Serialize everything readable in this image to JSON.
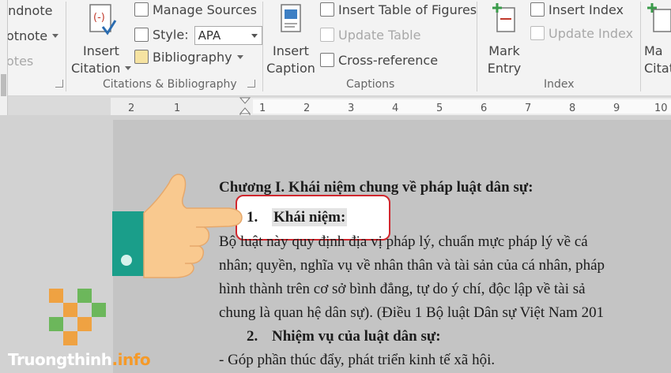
{
  "ribbon": {
    "footnotes": {
      "endnote_label": "Endnote",
      "footnote_label": "otnote",
      "notes_label": "otes"
    },
    "citations_bibliography": {
      "insert_citation_line1": "Insert",
      "insert_citation_line2": "Citation",
      "manage_sources": "Manage Sources",
      "style_label": "Style:",
      "style_value": "APA",
      "bibliography": "Bibliography",
      "group_label": "Citations & Bibliography"
    },
    "captions": {
      "insert_caption_line1": "Insert",
      "insert_caption_line2": "Caption",
      "insert_table_of_figures": "Insert Table of Figures",
      "update_table": "Update Table",
      "cross_reference": "Cross-reference",
      "group_label": "Captions"
    },
    "index": {
      "mark_entry_line1": "Mark",
      "mark_entry_line2": "Entry",
      "insert_index": "Insert Index",
      "update_index": "Update Index",
      "group_label": "Index"
    },
    "next_group": {
      "line1": "Ma",
      "line2": "Citat"
    }
  },
  "ruler": {
    "ticks": [
      "2",
      "1",
      "1",
      "2",
      "3",
      "4",
      "5",
      "6",
      "7",
      "8",
      "9",
      "10"
    ]
  },
  "document": {
    "chapter_heading": "Chương I. Khái niệm chung về pháp luật dân sự:",
    "item1_number": "1.",
    "item1_title": "Khái niệm:",
    "para_line1": "Bộ luật này quy định địa vị pháp lý, chuẩn mực pháp lý về cá",
    "para_line2": "nhân; quyền, nghĩa vụ về nhân thân và tài sản của cá nhân, pháp",
    "para_line3": "hình thành trên cơ sở bình đẳng, tự do ý chí, độc lập về tài sả",
    "para_line4": "chung là quan hệ dân sự). (Điều 1 Bộ luật Dân sự Việt Nam 201",
    "item2_number": "2.",
    "item2_title": "Nhiệm vụ của luật dân sự:",
    "bullet_line": "- Góp phần thúc đẩy, phát triển kinh tế xã hội."
  },
  "watermark": {
    "brand": "Truongthinh",
    "suffix": ".info"
  },
  "colors": {
    "callout_border": "#d0272e",
    "hand_skin": "#f9c98f",
    "cuff": "#1a9e8a",
    "watermark_orange": "#f59a29",
    "watermark_green": "#5bb347"
  }
}
